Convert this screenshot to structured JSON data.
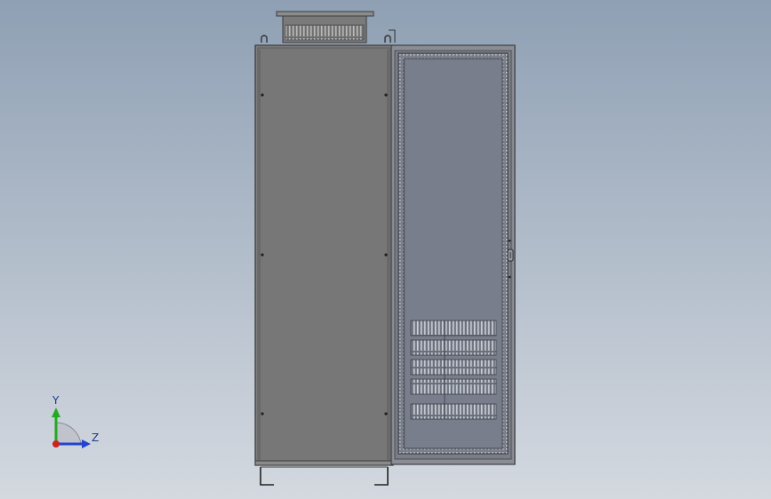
{
  "viewport": {
    "background_top": "#8fa0b4",
    "background_bottom": "#d4d9e0"
  },
  "model": {
    "cabinet_body_color": "#777777",
    "cabinet_edge_color": "#4a4a4a",
    "door_frame_color": "#8a8d93",
    "door_panel_color": "#797e8c",
    "vent_color": "#aab0bb"
  },
  "triad": {
    "y_label": "Y",
    "z_label": "Z",
    "y_color": "#22aa22",
    "z_color": "#2244cc",
    "x_color": "#cc2222"
  }
}
